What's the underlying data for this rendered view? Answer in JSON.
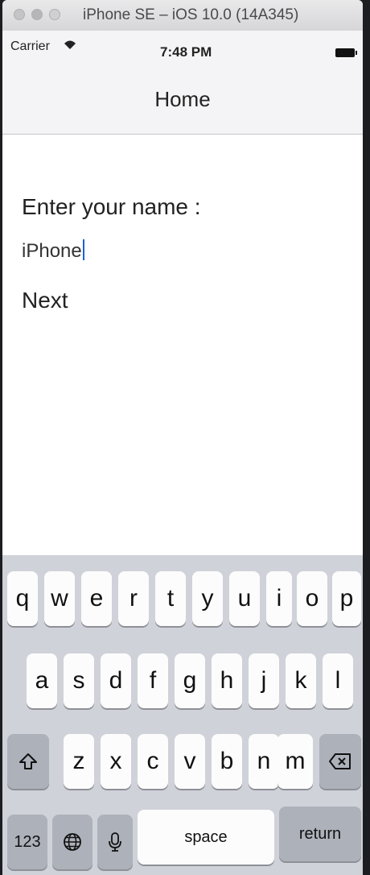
{
  "window": {
    "title": "iPhone SE – iOS 10.0 (14A345)"
  },
  "status_bar": {
    "carrier": "Carrier",
    "time": "7:48 PM"
  },
  "nav": {
    "title": "Home"
  },
  "content": {
    "prompt_label": "Enter your name :",
    "name_value": "iPhone",
    "next_label": "Next"
  },
  "keyboard": {
    "row1": [
      "q",
      "w",
      "e",
      "r",
      "t",
      "y",
      "u",
      "i",
      "o",
      "p"
    ],
    "row2": [
      "a",
      "s",
      "d",
      "f",
      "g",
      "h",
      "j",
      "k",
      "l"
    ],
    "row3": [
      "z",
      "x",
      "c",
      "v",
      "b",
      "n",
      "m"
    ],
    "numbers_label": "123",
    "space_label": "space",
    "return_label": "return",
    "icons": [
      "shift-icon",
      "backspace-icon",
      "globe-icon",
      "microphone-icon",
      "wifi-icon",
      "battery-icon"
    ]
  }
}
